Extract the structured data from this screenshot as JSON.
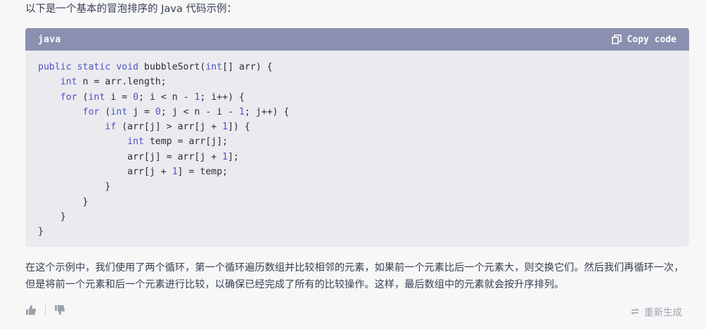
{
  "intro": "以下是一个基本的冒泡排序的 Java 代码示例：",
  "code_block": {
    "language": "java",
    "copy_label": "Copy code",
    "copy_icon": "copy-icon",
    "lines": [
      "public static void bubbleSort(int[] arr) {",
      "    int n = arr.length;",
      "    for (int i = 0; i < n - 1; i++) {",
      "        for (int j = 0; j < n - i - 1; j++) {",
      "            if (arr[j] > arr[j + 1]) {",
      "                int temp = arr[j];",
      "                arr[j] = arr[j + 1];",
      "                arr[j + 1] = temp;",
      "            }",
      "        }",
      "    }",
      "}"
    ]
  },
  "paragraph": "在这个示例中，我们使用了两个循环，第一个循环遍历数组并比较相邻的元素，如果前一个元素比后一个元素大，则交换它们。然后我们再循环一次，但是将前一个元素和后一个元素进行比较，以确保已经完成了所有的比较操作。这样，最后数组中的元素就会按升序排列。",
  "footer": {
    "thumbs_up_icon": "thumbs-up-icon",
    "thumbs_down_icon": "thumbs-down-icon",
    "regenerate_icon": "refresh-icon",
    "regenerate_label": "重新生成"
  },
  "colors": {
    "header_bg": "#8b8fb0",
    "code_bg": "#ebebef",
    "keyword": "#4b53c8",
    "page_bg": "#f7f7f8"
  }
}
